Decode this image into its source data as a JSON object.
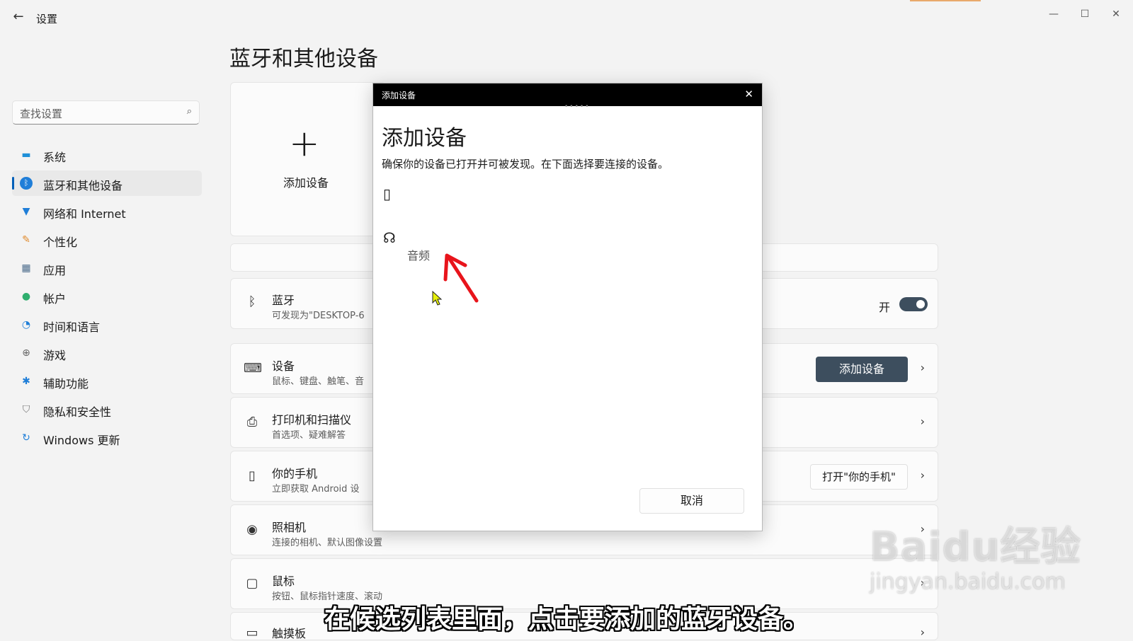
{
  "window": {
    "title": "设置",
    "back_icon": "back-arrow-icon",
    "controls": [
      "minimize-icon",
      "maximize-icon",
      "close-icon"
    ]
  },
  "search": {
    "placeholder": "查找设置"
  },
  "sidebar": {
    "items": [
      {
        "label": "系统",
        "icon": "system-icon",
        "active": false
      },
      {
        "label": "蓝牙和其他设备",
        "icon": "bluetooth-icon",
        "active": true
      },
      {
        "label": "网络和 Internet",
        "icon": "network-icon",
        "active": false
      },
      {
        "label": "个性化",
        "icon": "brush-icon",
        "active": false
      },
      {
        "label": "应用",
        "icon": "apps-icon",
        "active": false
      },
      {
        "label": "帐户",
        "icon": "account-icon",
        "active": false
      },
      {
        "label": "时间和语言",
        "icon": "time-language-icon",
        "active": false
      },
      {
        "label": "游戏",
        "icon": "gaming-icon",
        "active": false
      },
      {
        "label": "辅助功能",
        "icon": "accessibility-icon",
        "active": false
      },
      {
        "label": "隐私和安全性",
        "icon": "shield-icon",
        "active": false
      },
      {
        "label": "Windows 更新",
        "icon": "update-icon",
        "active": false
      }
    ]
  },
  "main": {
    "title": "蓝牙和其他设备",
    "add_card_label": "添加设备",
    "bluetooth": {
      "title": "蓝牙",
      "subtitle": "可发现为\"DESKTOP-6",
      "toggle_label": "开",
      "toggle_on": true
    },
    "rows": [
      {
        "title": "设备",
        "subtitle": "鼠标、键盘、触笔、音",
        "button": "添加设备"
      },
      {
        "title": "打印机和扫描仪",
        "subtitle": "首选项、疑难解答"
      },
      {
        "title": "你的手机",
        "subtitle": "立即获取 Android 设",
        "button": "打开\"你的手机\""
      },
      {
        "title": "照相机",
        "subtitle": "连接的相机、默认图像设置"
      },
      {
        "title": "鼠标",
        "subtitle": "按钮、鼠标指针速度、滚动"
      },
      {
        "title": "触摸板",
        "subtitle": ""
      }
    ]
  },
  "dialog": {
    "bar_title": "添加设备",
    "heading": "添加设备",
    "description": "确保你的设备已打开并可被发现。在下面选择要连接的设备。",
    "devices": [
      {
        "icon": "phone-icon",
        "label": ""
      },
      {
        "icon": "headset-icon",
        "label": "音频"
      }
    ],
    "cancel_label": "取消"
  },
  "overlay": {
    "caption": "在候选列表里面，点击要添加的蓝牙设备。",
    "watermark_brand": "Baidu经验",
    "watermark_url": "jingyan.baidu.com"
  },
  "colors": {
    "accent_button": "#3d4e5e",
    "annotation_arrow": "#e8141b",
    "nav_indicator": "#005fb8"
  }
}
